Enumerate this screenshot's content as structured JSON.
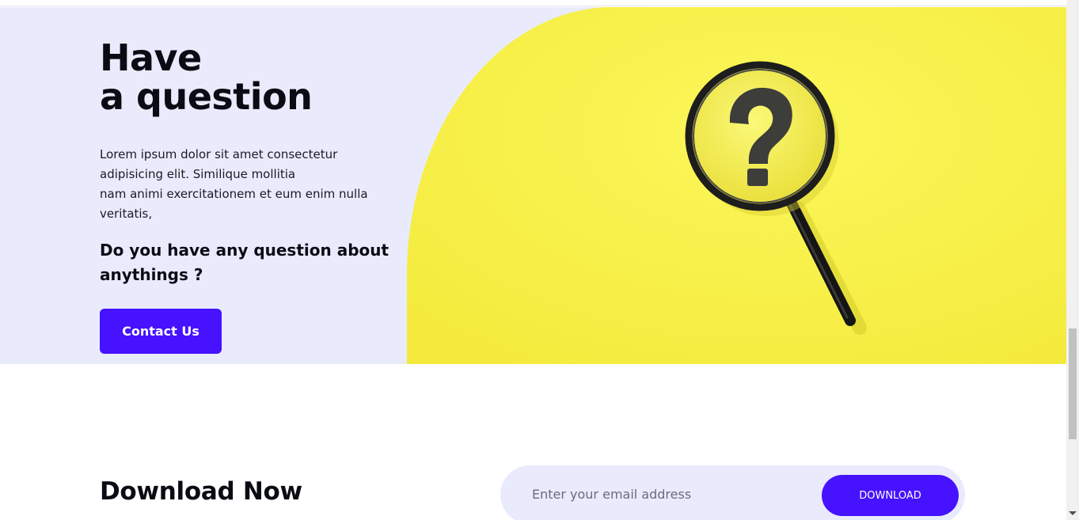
{
  "hero": {
    "title_line1": "Have",
    "title_line2": "a question",
    "body_line1": "Lorem ipsum dolor sit amet consectetur adipisicing elit. Similique mollitia",
    "body_line2": "nam animi exercitationem et eum enim nulla veritatis,",
    "question": "Do you have any question about anythings ?",
    "contact_label": "Contact Us",
    "image_icon": "magnifying-glass-question-mark"
  },
  "download": {
    "title": "Download Now",
    "email_placeholder": "Enter your email address",
    "button_label": "DOWNLOAD"
  },
  "colors": {
    "accent": "#4612ff",
    "hero_bg": "#e9ebfd",
    "image_bg": "#f8f24c",
    "text_dark": "#0b0b14"
  }
}
